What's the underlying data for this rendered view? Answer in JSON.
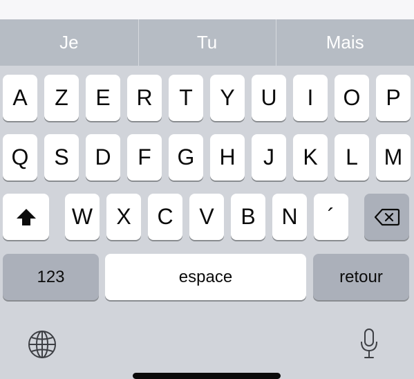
{
  "suggestions": [
    "Je",
    "Tu",
    "Mais"
  ],
  "rows": {
    "row1": [
      "A",
      "Z",
      "E",
      "R",
      "T",
      "Y",
      "U",
      "I",
      "O",
      "P"
    ],
    "row2": [
      "Q",
      "S",
      "D",
      "F",
      "G",
      "H",
      "J",
      "K",
      "L",
      "M"
    ],
    "row3": [
      "W",
      "X",
      "C",
      "V",
      "B",
      "N",
      "´"
    ]
  },
  "keys": {
    "numbers": "123",
    "space": "espace",
    "return": "retour"
  },
  "icons": {
    "shift": "shift-icon",
    "delete": "delete-icon",
    "globe": "globe-icon",
    "mic": "microphone-icon"
  },
  "colors": {
    "key": "#ffffff",
    "function_key": "#abb0ba",
    "keyboard_background": "#d1d4da",
    "suggestion_bar": "#b6bcc4"
  }
}
